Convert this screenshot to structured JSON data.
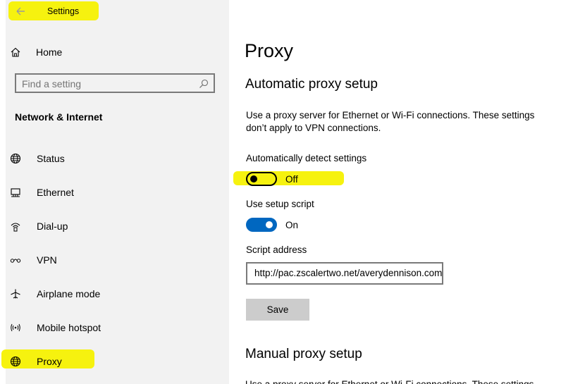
{
  "window": {
    "title": "Settings"
  },
  "sidebar": {
    "home_label": "Home",
    "search_placeholder": "Find a setting",
    "section_heading": "Network & Internet",
    "items": [
      {
        "label": "Status",
        "icon": "globe-icon"
      },
      {
        "label": "Ethernet",
        "icon": "ethernet-icon"
      },
      {
        "label": "Dial-up",
        "icon": "dialup-icon"
      },
      {
        "label": "VPN",
        "icon": "vpn-icon"
      },
      {
        "label": "Airplane mode",
        "icon": "airplane-icon"
      },
      {
        "label": "Mobile hotspot",
        "icon": "hotspot-icon"
      },
      {
        "label": "Proxy",
        "icon": "globe-icon"
      }
    ]
  },
  "main": {
    "page_title": "Proxy",
    "automatic": {
      "heading": "Automatic proxy setup",
      "description": "Use a proxy server for Ethernet or Wi-Fi connections. These settings don’t apply to VPN connections.",
      "detect_label": "Automatically detect settings",
      "detect_state": "Off",
      "script_label": "Use setup script",
      "script_state": "On",
      "address_label": "Script address",
      "address_value": "http://pac.zscalertwo.net/averydennison.com",
      "save_label": "Save"
    },
    "manual": {
      "heading": "Manual proxy setup",
      "description": "Use a proxy server for Ethernet or Wi-Fi connections. These settings"
    }
  },
  "colors": {
    "highlight": "#f6f20f",
    "toggle_on": "#0067c0",
    "sidebar_bg": "#f2f2f2"
  }
}
